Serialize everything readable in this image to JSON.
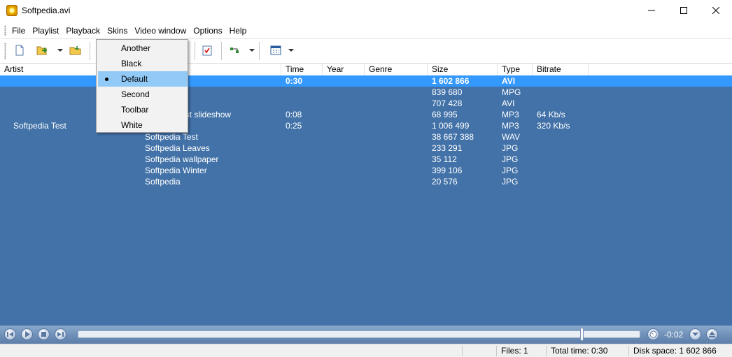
{
  "window": {
    "title": "Softpedia.avi"
  },
  "menu": [
    "File",
    "Playlist",
    "Playback",
    "Skins",
    "Video window",
    "Options",
    "Help"
  ],
  "columns": [
    "Artist",
    "Time",
    "Year",
    "Genre",
    "Size",
    "Type",
    "Bitrate"
  ],
  "rows": [
    {
      "artist": "",
      "title": "",
      "time": "0:30",
      "year": "",
      "genre": "",
      "size": "1 602 866",
      "type": "AVI",
      "bitrate": ""
    },
    {
      "artist": "",
      "title": "",
      "time": "",
      "year": "",
      "genre": "",
      "size": "839 680",
      "type": "MPG",
      "bitrate": ""
    },
    {
      "artist": "",
      "title": "",
      "time": "",
      "year": "",
      "genre": "",
      "size": "707 428",
      "type": "AVI",
      "bitrate": ""
    },
    {
      "artist": "",
      "title": "est slideshow",
      "time": "0:08",
      "year": "",
      "genre": "",
      "size": "68 995",
      "type": "MP3",
      "bitrate": "64 Kb/s"
    },
    {
      "artist": "Softpedia Test",
      "title": "",
      "time": "0:25",
      "year": "",
      "genre": "",
      "size": "1 006 499",
      "type": "MP3",
      "bitrate": "320 Kb/s"
    },
    {
      "artist": "",
      "title": "Softpedia Test",
      "time": "",
      "year": "",
      "genre": "",
      "size": "38 667 388",
      "type": "WAV",
      "bitrate": ""
    },
    {
      "artist": "",
      "title": "Softpedia Leaves",
      "time": "",
      "year": "",
      "genre": "",
      "size": "233 291",
      "type": "JPG",
      "bitrate": ""
    },
    {
      "artist": "",
      "title": "Softpedia wallpaper",
      "time": "",
      "year": "",
      "genre": "",
      "size": "35 112",
      "type": "JPG",
      "bitrate": ""
    },
    {
      "artist": "",
      "title": "Softpedia Winter",
      "time": "",
      "year": "",
      "genre": "",
      "size": "399 106",
      "type": "JPG",
      "bitrate": ""
    },
    {
      "artist": "",
      "title": "Softpedia",
      "time": "",
      "year": "",
      "genre": "",
      "size": "20 576",
      "type": "JPG",
      "bitrate": ""
    }
  ],
  "selected_row": 0,
  "skins_menu": {
    "items": [
      "Another",
      "Black",
      "Default",
      "Second",
      "Toolbar",
      "White"
    ],
    "checked": "Default"
  },
  "transport": {
    "time_remaining": "-0:02",
    "seek_position": 0.9
  },
  "status": {
    "files": "Files: 1",
    "total_time": "Total time: 0:30",
    "disk_space": "Disk space: 1 602 866"
  },
  "colors": {
    "playlist_bg": "#4272a8",
    "selection": "#3399ff",
    "menu_highlight": "#91c9f7"
  }
}
